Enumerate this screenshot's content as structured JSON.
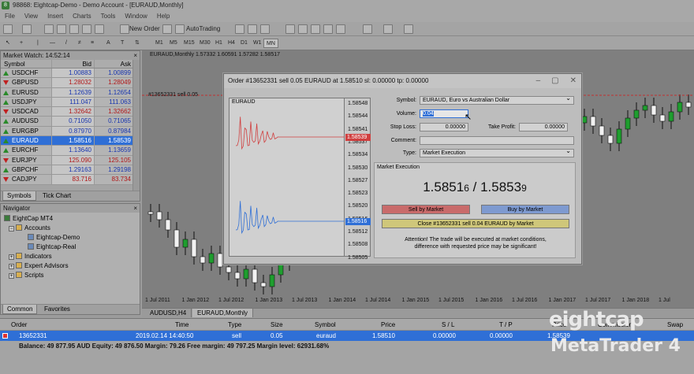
{
  "window": {
    "title": "98868: Eightcap-Demo - Demo Account - [EURAUD,Monthly]"
  },
  "menu": [
    "File",
    "View",
    "Insert",
    "Charts",
    "Tools",
    "Window",
    "Help"
  ],
  "toolbar": {
    "new_order": "New Order",
    "autotrading": "AutoTrading"
  },
  "timeframes": [
    "M1",
    "M5",
    "M15",
    "M30",
    "H1",
    "H4",
    "D1",
    "W1",
    "MN"
  ],
  "market_watch": {
    "title": "Market Watch: 14:52:14",
    "columns": {
      "symbol": "Symbol",
      "bid": "Bid",
      "ask": "Ask"
    },
    "rows": [
      {
        "symbol": "USDCHF",
        "bid": "1.00883",
        "ask": "1.00899",
        "dir": "up"
      },
      {
        "symbol": "GBPUSD",
        "bid": "1.28032",
        "ask": "1.28049",
        "dir": "down"
      },
      {
        "symbol": "EURUSD",
        "bid": "1.12639",
        "ask": "1.12654",
        "dir": "up"
      },
      {
        "symbol": "USDJPY",
        "bid": "111.047",
        "ask": "111.063",
        "dir": "up"
      },
      {
        "symbol": "USDCAD",
        "bid": "1.32642",
        "ask": "1.32662",
        "dir": "down"
      },
      {
        "symbol": "AUDUSD",
        "bid": "0.71050",
        "ask": "0.71065",
        "dir": "up"
      },
      {
        "symbol": "EURGBP",
        "bid": "0.87970",
        "ask": "0.87984",
        "dir": "up"
      },
      {
        "symbol": "EURAUD",
        "bid": "1.58516",
        "ask": "1.58539",
        "dir": "up",
        "selected": true
      },
      {
        "symbol": "EURCHF",
        "bid": "1.13640",
        "ask": "1.13659",
        "dir": "up"
      },
      {
        "symbol": "EURJPY",
        "bid": "125.090",
        "ask": "125.105",
        "dir": "down"
      },
      {
        "symbol": "GBPCHF",
        "bid": "1.29163",
        "ask": "1.29198",
        "dir": "up"
      },
      {
        "symbol": "CADJPY",
        "bid": "83.716",
        "ask": "83.734",
        "dir": "down"
      }
    ],
    "tabs": [
      "Symbols",
      "Tick Chart"
    ]
  },
  "navigator": {
    "title": "Navigator",
    "root": "EightCap MT4",
    "accounts": "Accounts",
    "account_items": [
      "Eightcap-Demo",
      "Eightcap-Real"
    ],
    "indicators": "Indicators",
    "experts": "Expert Advisors",
    "scripts": "Scripts",
    "tabs": [
      "Common",
      "Favorites"
    ]
  },
  "chart": {
    "title": "EURAUD,Monthly  1.57332 1.60591 1.57282 1.58517",
    "order_label": "#13652331 sell 0.05",
    "x_labels": [
      "1 Jul 2011",
      "1 Jan 2012",
      "1 Jul 2012",
      "1 Jan 2013",
      "1 Jul 2013",
      "1 Jan 2014",
      "1 Jul 2014",
      "1 Jan 2015",
      "1 Jul 2015",
      "1 Jan 2016",
      "1 Jul 2016",
      "1 Jan 2017",
      "1 Jul 2017",
      "1 Jan 2018",
      "1 Jul"
    ],
    "tabs": [
      "AUDUSD,H4",
      "EURAUD,Monthly"
    ]
  },
  "dialog": {
    "title": "Order #13652331 sell 0.05 EURAUD at 1.58510 sl: 0.00000 tp: 0.00000",
    "mini_symbol": "EURAUD",
    "y_labels": [
      "1.58548",
      "1.58544",
      "1.58541",
      "1.58537",
      "1.58534",
      "1.58530",
      "1.58527",
      "1.58523",
      "1.58520",
      "1.58516",
      "1.58512",
      "1.58508",
      "1.58505"
    ],
    "ask_tag": "1.58539",
    "bid_tag": "1.58516",
    "symbol_label": "Symbol:",
    "symbol_value": "EURAUD, Euro vs Australian Dollar",
    "volume_label": "Volume:",
    "volume_value": "0.04",
    "stoploss_label": "Stop Loss:",
    "stoploss_value": "0.00000",
    "takeprofit_label": "Take Profit:",
    "takeprofit_value": "0.00000",
    "comment_label": "Comment:",
    "type_label": "Type:",
    "type_value": "Market Execution",
    "section_title": "Market Execution",
    "bid_big": "1.5851",
    "bid_small": "6",
    "separator": " / ",
    "ask_big": "1.5853",
    "ask_small": "9",
    "sell_button": "Sell by Market",
    "buy_button": "Buy by Market",
    "close_button": "Close #13652331 sell 0.04 EURAUD by Market",
    "warning": "Attention! The trade will be executed at market conditions, difference with requested price may be significant!"
  },
  "terminal": {
    "columns": [
      "Order",
      "Time",
      "Type",
      "Size",
      "Symbol",
      "Price",
      "S / L",
      "T / P",
      "Price",
      "Commission",
      "Swap"
    ],
    "row": {
      "order": "13652331",
      "time": "2019.02.14 14:40:50",
      "type": "sell",
      "size": "0.05",
      "symbol": "euraud",
      "price": "1.58510",
      "sl": "0.00000",
      "tp": "0.00000",
      "cur_price": "1.58539"
    },
    "balance": "Balance: 49 877.95 AUD  Equity: 49 876.50  Margin: 79.26  Free margin: 49 797.25  Margin level: 62931.68%"
  },
  "logo": {
    "line1": "eightcap",
    "line2": "MetaTrader 4"
  }
}
